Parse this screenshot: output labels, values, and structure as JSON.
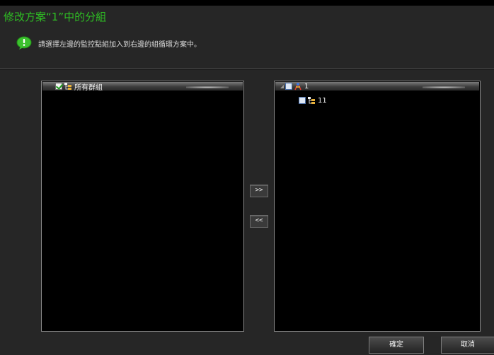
{
  "dialog": {
    "title": "修改方案“1”中的分組",
    "hint": "請選擇左邊的監控點組加入到右邊的組循環方案中。"
  },
  "left_tree": {
    "root": {
      "label": "所有群組",
      "checked": true
    }
  },
  "right_tree": {
    "root": {
      "label": "1",
      "checked": false,
      "expanded": true
    },
    "children": [
      {
        "label": "11",
        "checked": false
      }
    ]
  },
  "buttons": {
    "add": ">>",
    "remove": "<<",
    "ok": "確定",
    "cancel": "取消"
  },
  "colors": {
    "title": "#2fbf24",
    "background": "#262626",
    "panel": "#000000"
  },
  "icons": {
    "hint": "info-bubble-icon",
    "group": "group-tree-icon",
    "scheme": "scheme-icon"
  }
}
